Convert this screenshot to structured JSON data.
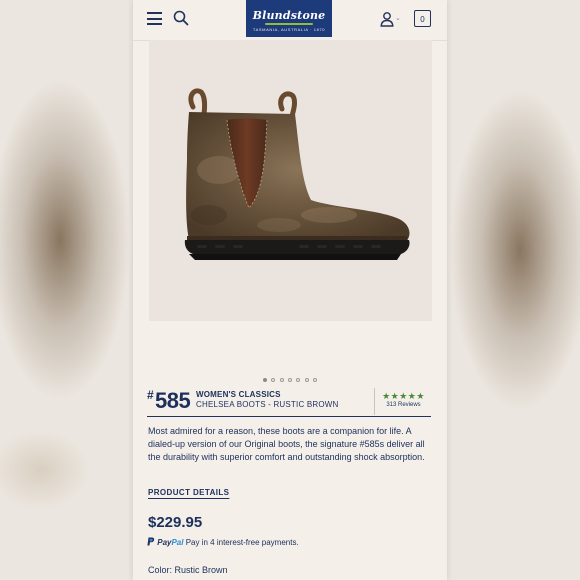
{
  "header": {
    "logo_text": "Blundstone",
    "logo_tagline": "TASMANIA, AUSTRALIA · 1870",
    "cart_count": "0",
    "icons": [
      "menu-icon",
      "search-icon",
      "user-icon",
      "chevron-down-icon",
      "cart-icon"
    ]
  },
  "gallery": {
    "dot_count": 7,
    "active_index": 0
  },
  "product": {
    "hash": "#",
    "model_number": "585",
    "collection": "WOMEN'S CLASSICS",
    "subtitle": "CHELSEA BOOTS - RUSTIC BROWN",
    "stars": "★★★★★",
    "reviews": "313 Reviews",
    "description": "Most admired for a reason, these boots are a companion for life. A dialed-up version of our Original boots, the signature #585s deliver all the durability with superior comfort and outstanding shock absorption.",
    "details_link": "PRODUCT DETAILS",
    "price": "$229.95",
    "paypal_brand_1": "Pay",
    "paypal_brand_2": "Pal",
    "paypal_text": "Pay in 4 interest-free payments.",
    "color_label": "Color:",
    "color_value": "Rustic Brown"
  },
  "colors": {
    "navy": "#1d2f5c",
    "logo_bg": "#1d3a7a",
    "star_green": "#4b8a3a",
    "background": "#f4f0e9"
  }
}
